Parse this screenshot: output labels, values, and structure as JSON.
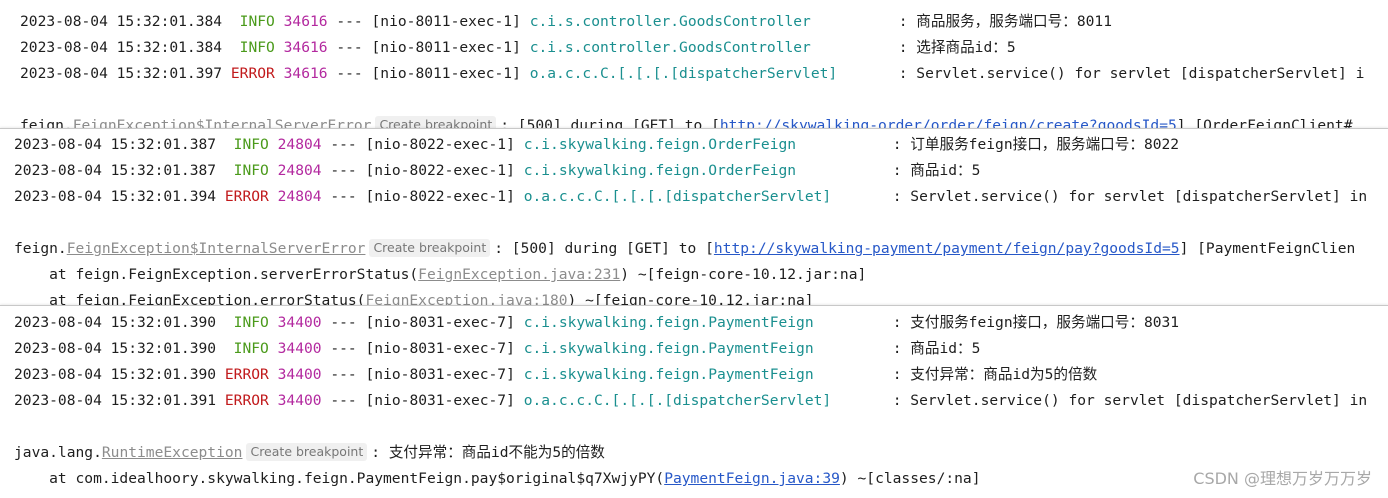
{
  "panels": [
    {
      "logs": [
        {
          "ts": "2023-08-04 15:32:01.384",
          "level": "INFO",
          "pid": "34616",
          "sep": "---",
          "thread": "[nio-8011-exec-1]",
          "logger": "c.i.s.controller.GoodsController",
          "msg": "商品服务，服务端口号：8011"
        },
        {
          "ts": "2023-08-04 15:32:01.384",
          "level": "INFO",
          "pid": "34616",
          "sep": "---",
          "thread": "[nio-8011-exec-1]",
          "logger": "c.i.s.controller.GoodsController",
          "msg": "选择商品id：5"
        },
        {
          "ts": "2023-08-04 15:32:01.397",
          "level": "ERROR",
          "pid": "34616",
          "sep": "---",
          "thread": "[nio-8011-exec-1]",
          "logger": "o.a.c.c.C.[.[.[.[dispatcherServlet]",
          "msg": "Servlet.service() for servlet [dispatcherServlet] i"
        }
      ],
      "exception": {
        "pkg": "feign.",
        "cls": "FeignException$InternalServerError",
        "bp": "Create breakpoint",
        "text": ": [500] during [GET] to [",
        "url": "http://skywalking-order/order/feign/create?goodsId=5",
        "tail": "] [OrderFeignClient#"
      }
    },
    {
      "logs": [
        {
          "ts": "2023-08-04 15:32:01.387",
          "level": "INFO",
          "pid": "24804",
          "sep": "---",
          "thread": "[nio-8022-exec-1]",
          "logger": "c.i.skywalking.feign.OrderFeign",
          "msg": "订单服务feign接口，服务端口号：8022"
        },
        {
          "ts": "2023-08-04 15:32:01.387",
          "level": "INFO",
          "pid": "24804",
          "sep": "---",
          "thread": "[nio-8022-exec-1]",
          "logger": "c.i.skywalking.feign.OrderFeign",
          "msg": "商品id：5"
        },
        {
          "ts": "2023-08-04 15:32:01.394",
          "level": "ERROR",
          "pid": "24804",
          "sep": "---",
          "thread": "[nio-8022-exec-1]",
          "logger": "o.a.c.c.C.[.[.[.[dispatcherServlet]",
          "msg": "Servlet.service() for servlet [dispatcherServlet] in"
        }
      ],
      "exception": {
        "pkg": "feign.",
        "cls": "FeignException$InternalServerError",
        "bp": "Create breakpoint",
        "text": ": [500] during [GET] to [",
        "url": "http://skywalking-payment/payment/feign/pay?goodsId=5",
        "tail": "] [PaymentFeignClien"
      },
      "stack": [
        {
          "pre": "    at feign.FeignException.serverErrorStatus(",
          "file": "FeignException.java:231",
          "post": ") ~[feign-core-10.12.jar:na]"
        },
        {
          "pre": "    at feign.FeignException.errorStatus(",
          "file": "FeignException.java:180",
          "post": ") ~[feign-core-10.12.jar:na]"
        }
      ]
    },
    {
      "logs": [
        {
          "ts": "2023-08-04 15:32:01.390",
          "level": "INFO",
          "pid": "34400",
          "sep": "---",
          "thread": "[nio-8031-exec-7]",
          "logger": "c.i.skywalking.feign.PaymentFeign",
          "msg": "支付服务feign接口，服务端口号：8031"
        },
        {
          "ts": "2023-08-04 15:32:01.390",
          "level": "INFO",
          "pid": "34400",
          "sep": "---",
          "thread": "[nio-8031-exec-7]",
          "logger": "c.i.skywalking.feign.PaymentFeign",
          "msg": "商品id：5"
        },
        {
          "ts": "2023-08-04 15:32:01.390",
          "level": "ERROR",
          "pid": "34400",
          "sep": "---",
          "thread": "[nio-8031-exec-7]",
          "logger": "c.i.skywalking.feign.PaymentFeign",
          "msg": "支付异常：商品id为5的倍数"
        },
        {
          "ts": "2023-08-04 15:32:01.391",
          "level": "ERROR",
          "pid": "34400",
          "sep": "---",
          "thread": "[nio-8031-exec-7]",
          "logger": "o.a.c.c.C.[.[.[.[dispatcherServlet]",
          "msg": "Servlet.service() for servlet [dispatcherServlet] in"
        }
      ],
      "exception": {
        "pkg": "java.lang.",
        "cls": "RuntimeException",
        "bp": "Create breakpoint",
        "text": ": 支付异常：商品id不能为5的倍数",
        "url": "",
        "tail": ""
      },
      "stack": [
        {
          "pre": "    at com.idealhoory.skywalking.feign.PaymentFeign.pay$original$q7XwjyPY(",
          "file": "PaymentFeign.java:39",
          "post": ") ~[classes/:na]"
        }
      ]
    }
  ],
  "watermark": "CSDN @理想万岁万万岁",
  "colors": {
    "info": "#4a9a1a",
    "error": "#c1191b",
    "pid": "#b3299f",
    "logger": "#1a8f8f",
    "link": "#2758c8"
  }
}
